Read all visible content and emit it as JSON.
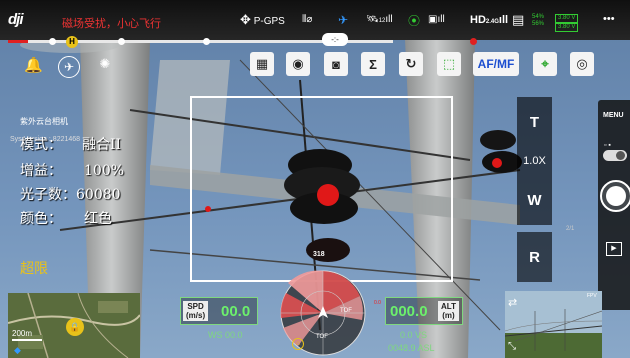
{
  "topbar": {
    "logo": "dji",
    "warning": "磁场受扰，小心飞行",
    "gps_mode": "P-GPS",
    "gps_sats": "12",
    "rc_label": "HD",
    "hd_sub": "2.4G",
    "battery_pct1": "54%",
    "battery_pct2": "56%",
    "battery_v1": "3.80 V",
    "battery_v2": "3.80 V",
    "more": "•••"
  },
  "track": {
    "home_badge": "H"
  },
  "toolbar": {
    "af_mf": "AF/MF",
    "sigma": "Σ",
    "center_pill": "-:-"
  },
  "camera_panel": {
    "title": "紫外云台相机",
    "sys_ver": "Sys Version : 8221468",
    "mode_label": "模式：",
    "mode_value": "融合II",
    "gain_label": "增益：",
    "gain_value": "100%",
    "photon_label": "光子数：",
    "photon_value": "60080",
    "color_label": "颜色：",
    "color_value": "红色",
    "limit_text": "超限"
  },
  "zoom": {
    "tele": "T",
    "level": "1.0X",
    "wide": "W",
    "reset": "R"
  },
  "right_panel": {
    "menu": "MENU"
  },
  "telemetry": {
    "spd_label": "SPD",
    "spd_unit": "(m/s)",
    "spd_value": "00.0",
    "ws": "WS 00.0",
    "alt_label": "ALT",
    "alt_unit": "(m)",
    "alt_value": "000.0",
    "vs": "0.0  VS",
    "asl": "0048.9 ASL",
    "heading": "318",
    "tof": "TOF",
    "red_small": "0.0"
  },
  "map": {
    "scale": "200m"
  },
  "pip": {
    "label": "FPV"
  },
  "status_codes": {
    "right": "2/1"
  }
}
